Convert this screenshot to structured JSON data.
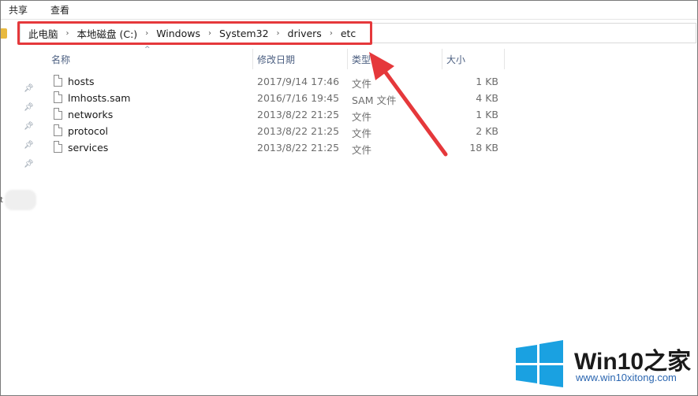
{
  "ribbon": {
    "tabs": [
      "共享",
      "查看"
    ]
  },
  "address": {
    "crumbs": [
      "此电脑",
      "本地磁盘 (C:)",
      "Windows",
      "System32",
      "drivers",
      "etc"
    ]
  },
  "columns": {
    "name": "名称",
    "date": "修改日期",
    "type": "类型",
    "size": "大小"
  },
  "files": [
    {
      "name": "hosts",
      "date": "2017/9/14 17:46",
      "type": "文件",
      "size": "1 KB"
    },
    {
      "name": "lmhosts.sam",
      "date": "2016/7/16 19:45",
      "type": "SAM 文件",
      "size": "4 KB"
    },
    {
      "name": "networks",
      "date": "2013/8/22 21:25",
      "type": "文件",
      "size": "1 KB"
    },
    {
      "name": "protocol",
      "date": "2013/8/22 21:25",
      "type": "文件",
      "size": "2 KB"
    },
    {
      "name": "services",
      "date": "2013/8/22 21:25",
      "type": "文件",
      "size": "18 KB"
    }
  ],
  "nav": {
    "partial_text": "t"
  },
  "watermark": {
    "title_main": "Win10",
    "title_suffix": "之家",
    "url": "www.win10xitong.com"
  },
  "colors": {
    "highlight": "#e5383b",
    "win_blue": "#1aa1e1",
    "url_blue": "#2b66b0"
  }
}
